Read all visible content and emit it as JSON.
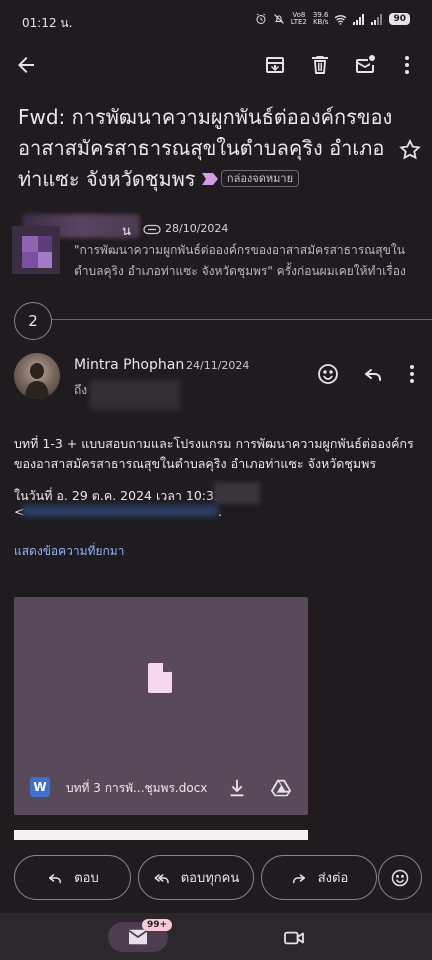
{
  "status_bar": {
    "time": "01:12 น.",
    "network_top": "Vo8",
    "network_bottom": "LTE2",
    "speed_top": "39.6",
    "speed_bottom": "KB/s",
    "battery": "90"
  },
  "toolbar": {
    "back_icon": "arrow-back-icon",
    "archive_icon": "archive-icon",
    "delete_icon": "trash-icon",
    "mark_unread_icon": "mark-unread-icon",
    "more_icon": "more-vert-icon"
  },
  "subject": {
    "text": "Fwd: การพัฒนาความผูกพันธ์ต่อองค์กรของอาสาสมัครสาธารณสุขในตำบลคุริง อำเภอท่าแซะ จังหวัดชุมพร",
    "label": "กล่องจดหมาย",
    "star_icon": "star-outline-icon"
  },
  "message1": {
    "sender_visible": "น",
    "date": "28/10/2024",
    "snippet": "\"การพัฒนาความผูกพันธ์ต่อองค์กรของอาสาสมัครสาธารณสุขในตำบลคุริง อำเภอท่าแซะ จังหวัดชุมพร\" ครั้งก่อนผมเคยให้ทำเรื่อง"
  },
  "thread": {
    "collapsed_count": "2"
  },
  "message2": {
    "sender": "Mintra Phophan",
    "date": "24/11/2024",
    "to_prefix": "ถึง",
    "body": "บทที่ 1-3 + แบบสอบถามและโปรงแกรม การพัฒนาความผูกพันธ์ต่อองค์กรของอาสาสมัครสาธารณสุขในตำบลคุริง อำเภอท่าแซะ จังหวัดชุมพร",
    "forward_line": "ในวันที่ อ. 29 ต.ค. 2024 เวลา 10:33 T",
    "email_line_start": "<",
    "email_line_end": ".",
    "show_trimmed": "แสดงข้อความที่ยกมา"
  },
  "attachment": {
    "type_badge": "W",
    "filename": "บทที่ 3 การพั...ชุมพร.docx"
  },
  "actions": {
    "reply": "ตอบ",
    "reply_all": "ตอบทุกคน",
    "forward": "ส่งต่อ"
  },
  "bottom_nav": {
    "mail_badge": "99+"
  },
  "colors": {
    "background": "#1f1b1f",
    "link": "#8fb4f8",
    "attachment_card": "#594a5a",
    "label_arrow": "#d39be6"
  }
}
